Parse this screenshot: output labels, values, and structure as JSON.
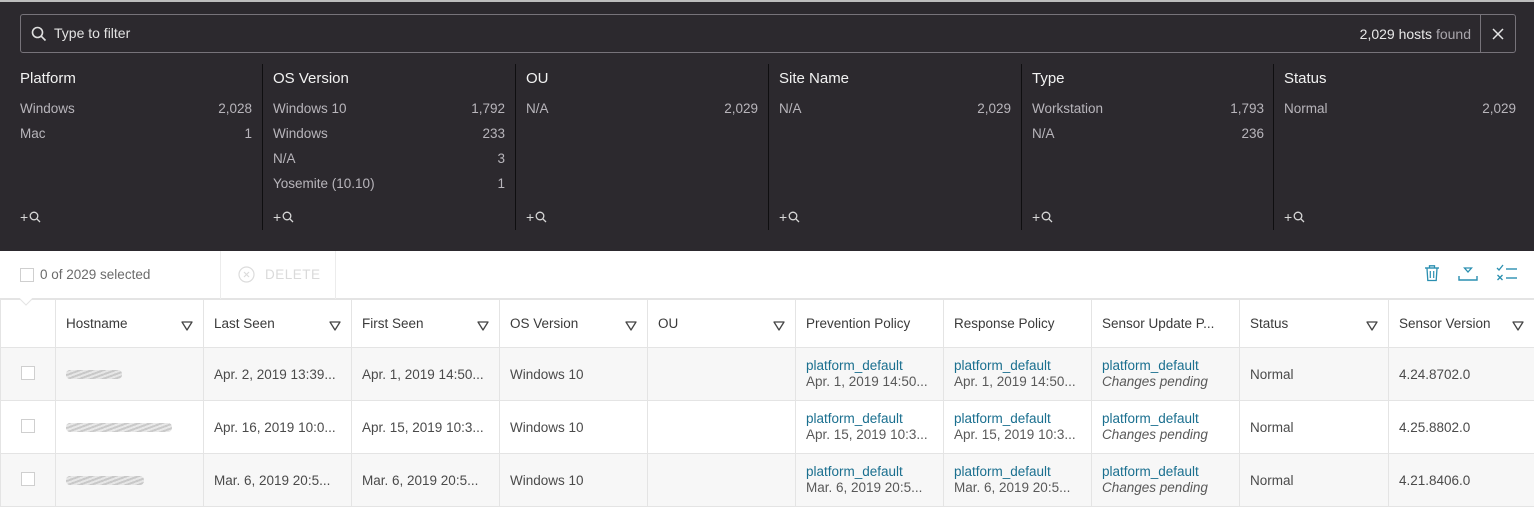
{
  "search": {
    "placeholder": "Type to filter",
    "count": "2,029 hosts",
    "found_word": "found",
    "icon": "search-icon",
    "clear_icon": "close-icon"
  },
  "facets": [
    {
      "title": "Platform",
      "items": [
        {
          "label": "Windows",
          "count": "2,028"
        },
        {
          "label": "Mac",
          "count": "1"
        }
      ]
    },
    {
      "title": "OS Version",
      "items": [
        {
          "label": "Windows 10",
          "count": "1,792"
        },
        {
          "label": "Windows",
          "count": "233"
        },
        {
          "label": "N/A",
          "count": "3"
        },
        {
          "label": "Yosemite (10.10)",
          "count": "1"
        }
      ]
    },
    {
      "title": "OU",
      "items": [
        {
          "label": "N/A",
          "count": "2,029"
        }
      ]
    },
    {
      "title": "Site Name",
      "items": [
        {
          "label": "N/A",
          "count": "2,029"
        }
      ]
    },
    {
      "title": "Type",
      "items": [
        {
          "label": "Workstation",
          "count": "1,793"
        },
        {
          "label": "N/A",
          "count": "236"
        }
      ]
    },
    {
      "title": "Status",
      "items": [
        {
          "label": "Normal",
          "count": "2,029"
        }
      ]
    }
  ],
  "toolbar": {
    "selected": "0 of 2029 selected",
    "delete_label": "DELETE",
    "icons": [
      "trash-icon",
      "download-icon",
      "checklist-icon"
    ]
  },
  "colors": {
    "panel_bg": "#2c292e",
    "link": "#1a6f8f",
    "accent_icon": "#2a8fb0"
  },
  "table": {
    "columns": [
      {
        "label": "",
        "sortable": false
      },
      {
        "label": "Hostname",
        "sortable": true
      },
      {
        "label": "Last Seen",
        "sortable": true
      },
      {
        "label": "First Seen",
        "sortable": true
      },
      {
        "label": "OS Version",
        "sortable": true
      },
      {
        "label": "OU",
        "sortable": true
      },
      {
        "label": "Prevention Policy",
        "sortable": false
      },
      {
        "label": "Response Policy",
        "sortable": false
      },
      {
        "label": "Sensor Update P...",
        "sortable": false
      },
      {
        "label": "Status",
        "sortable": true
      },
      {
        "label": "Sensor Version",
        "sortable": true
      }
    ],
    "rows": [
      {
        "hostname": "(redacted)",
        "last_seen": "Apr. 2, 2019 13:39...",
        "first_seen": "Apr. 1, 2019 14:50...",
        "os_version": "Windows 10",
        "ou": "",
        "prevention_policy": {
          "name": "platform_default",
          "date": "Apr. 1, 2019 14:50..."
        },
        "response_policy": {
          "name": "platform_default",
          "date": "Apr. 1, 2019 14:50..."
        },
        "sensor_update_policy": {
          "name": "platform_default",
          "note": "Changes pending"
        },
        "status": "Normal",
        "sensor_version": "4.24.8702.0"
      },
      {
        "hostname": "(redacted)",
        "last_seen": "Apr. 16, 2019 10:0...",
        "first_seen": "Apr. 15, 2019 10:3...",
        "os_version": "Windows 10",
        "ou": "",
        "prevention_policy": {
          "name": "platform_default",
          "date": "Apr. 15, 2019 10:3..."
        },
        "response_policy": {
          "name": "platform_default",
          "date": "Apr. 15, 2019 10:3..."
        },
        "sensor_update_policy": {
          "name": "platform_default",
          "note": "Changes pending"
        },
        "status": "Normal",
        "sensor_version": "4.25.8802.0"
      },
      {
        "hostname": "(redacted)",
        "last_seen": "Mar. 6, 2019 20:5...",
        "first_seen": "Mar. 6, 2019 20:5...",
        "os_version": "Windows 10",
        "ou": "",
        "prevention_policy": {
          "name": "platform_default",
          "date": "Mar. 6, 2019 20:5..."
        },
        "response_policy": {
          "name": "platform_default",
          "date": "Mar. 6, 2019 20:5..."
        },
        "sensor_update_policy": {
          "name": "platform_default",
          "note": "Changes pending"
        },
        "status": "Normal",
        "sensor_version": "4.21.8406.0"
      }
    ]
  }
}
